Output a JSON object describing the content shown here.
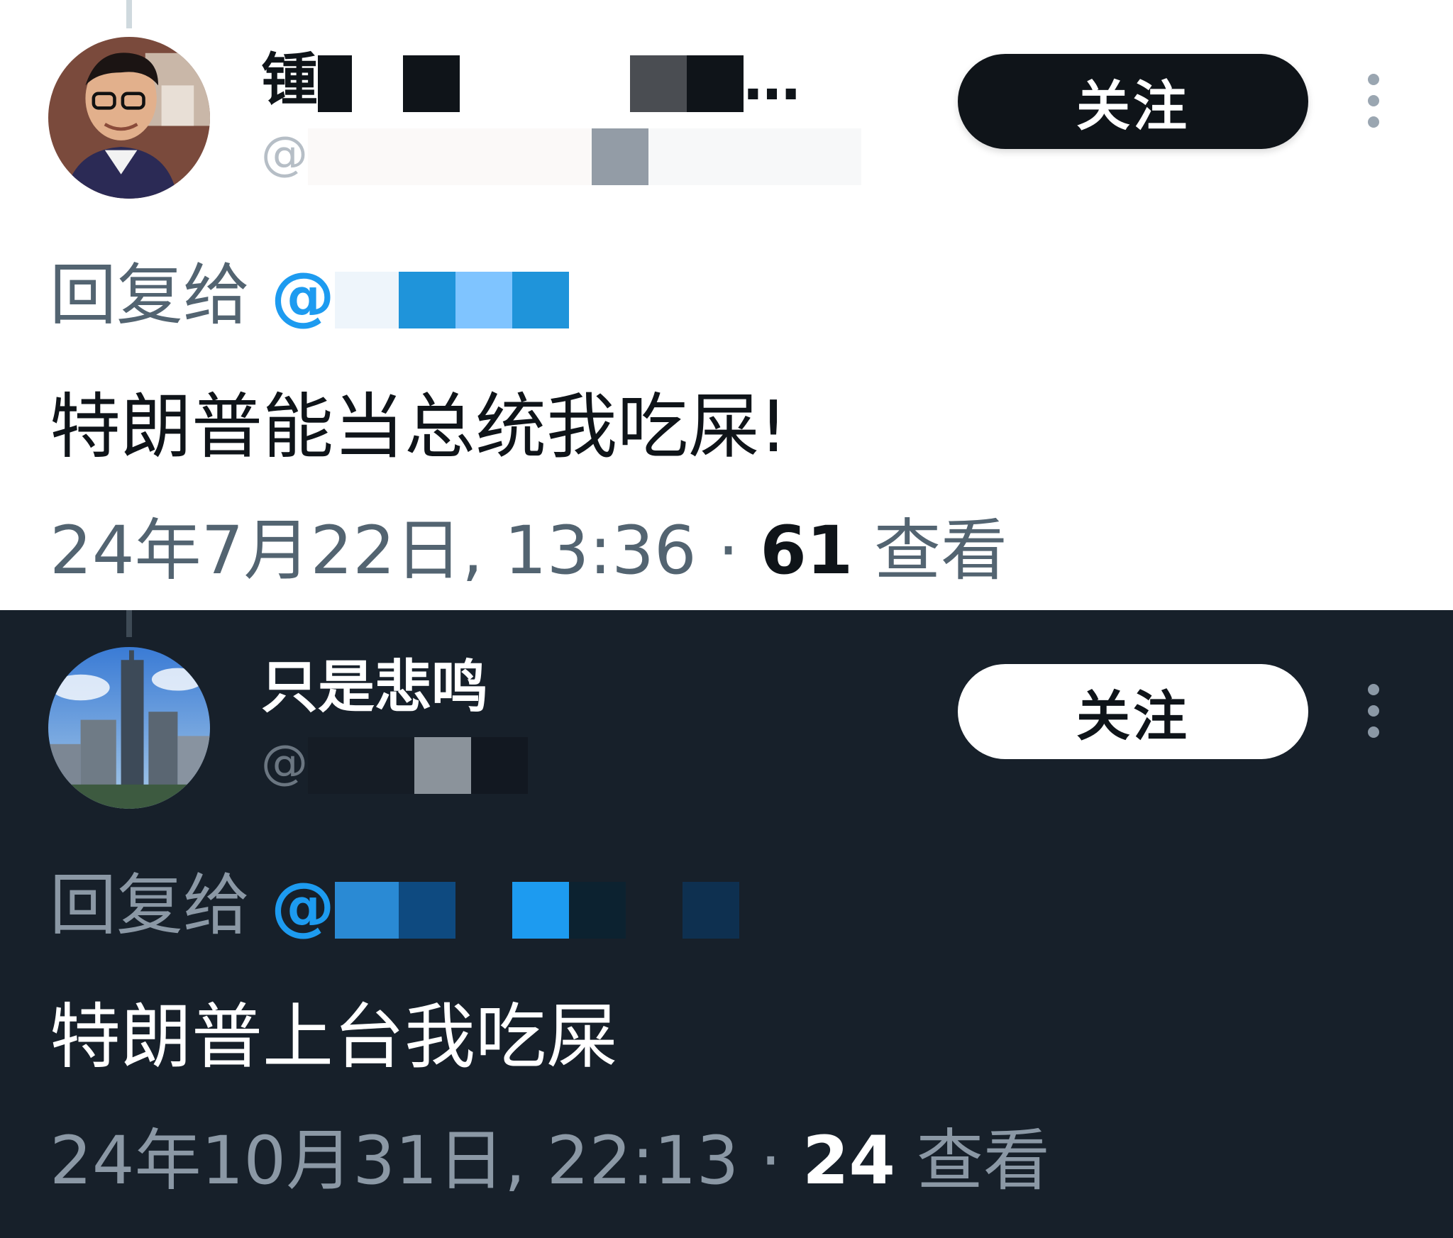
{
  "tweets": [
    {
      "theme": "light",
      "display_name": "锺",
      "display_name_suffix": "…",
      "handle_prefix": "@",
      "follow_label": "关注",
      "reply_prefix": "回复给",
      "reply_at": "@",
      "text": "特朗普能当总统我吃屎!",
      "date": "24年7月22日, 13:36",
      "separator": " · ",
      "views": "61",
      "views_label": "查看"
    },
    {
      "theme": "dark",
      "display_name": "只是悲鸣",
      "display_name_suffix": "",
      "handle_prefix": "@",
      "follow_label": "关注",
      "reply_prefix": "回复给",
      "reply_at": "@",
      "text": "特朗普上台我吃屎",
      "date": "24年10月31日, 22:13",
      "separator": " · ",
      "views": "24",
      "views_label": "查看"
    }
  ],
  "colors": {
    "accent": "#1d9bf0",
    "dark_bg": "#17202a",
    "light_bg": "#ffffff"
  }
}
